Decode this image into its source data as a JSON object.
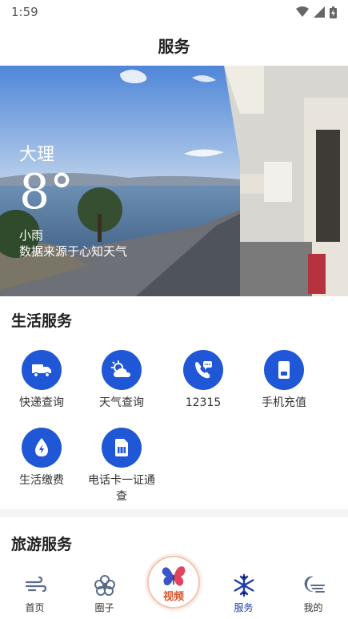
{
  "status_bar": {
    "time": "1:59"
  },
  "header": {
    "title": "服务"
  },
  "weather": {
    "city": "大理",
    "temperature": "8°",
    "condition": "小雨",
    "source": "数据来源于心知天气"
  },
  "life_services": {
    "title": "生活服务",
    "items": [
      {
        "label": "快递查询",
        "icon": "truck-icon"
      },
      {
        "label": "天气查询",
        "icon": "cloud-sun-icon"
      },
      {
        "label": "12315",
        "icon": "phone-chat-icon"
      },
      {
        "label": "手机充值",
        "icon": "mobile-phone-icon"
      },
      {
        "label": "生活缴费",
        "icon": "water-drop-icon"
      },
      {
        "label": "电话卡一证通查",
        "icon": "sim-card-icon"
      }
    ]
  },
  "travel_services": {
    "title": "旅游服务"
  },
  "bottom_nav": {
    "items": [
      {
        "label": "首页",
        "icon": "wind-icon"
      },
      {
        "label": "圈子",
        "icon": "flower-icon"
      },
      {
        "label": "视频",
        "icon": "butterfly-icon"
      },
      {
        "label": "服务",
        "icon": "snowflake-icon"
      },
      {
        "label": "我的",
        "icon": "moon-icon"
      }
    ]
  },
  "colors": {
    "accent": "#1f57d6",
    "video_label": "#d6532b"
  }
}
